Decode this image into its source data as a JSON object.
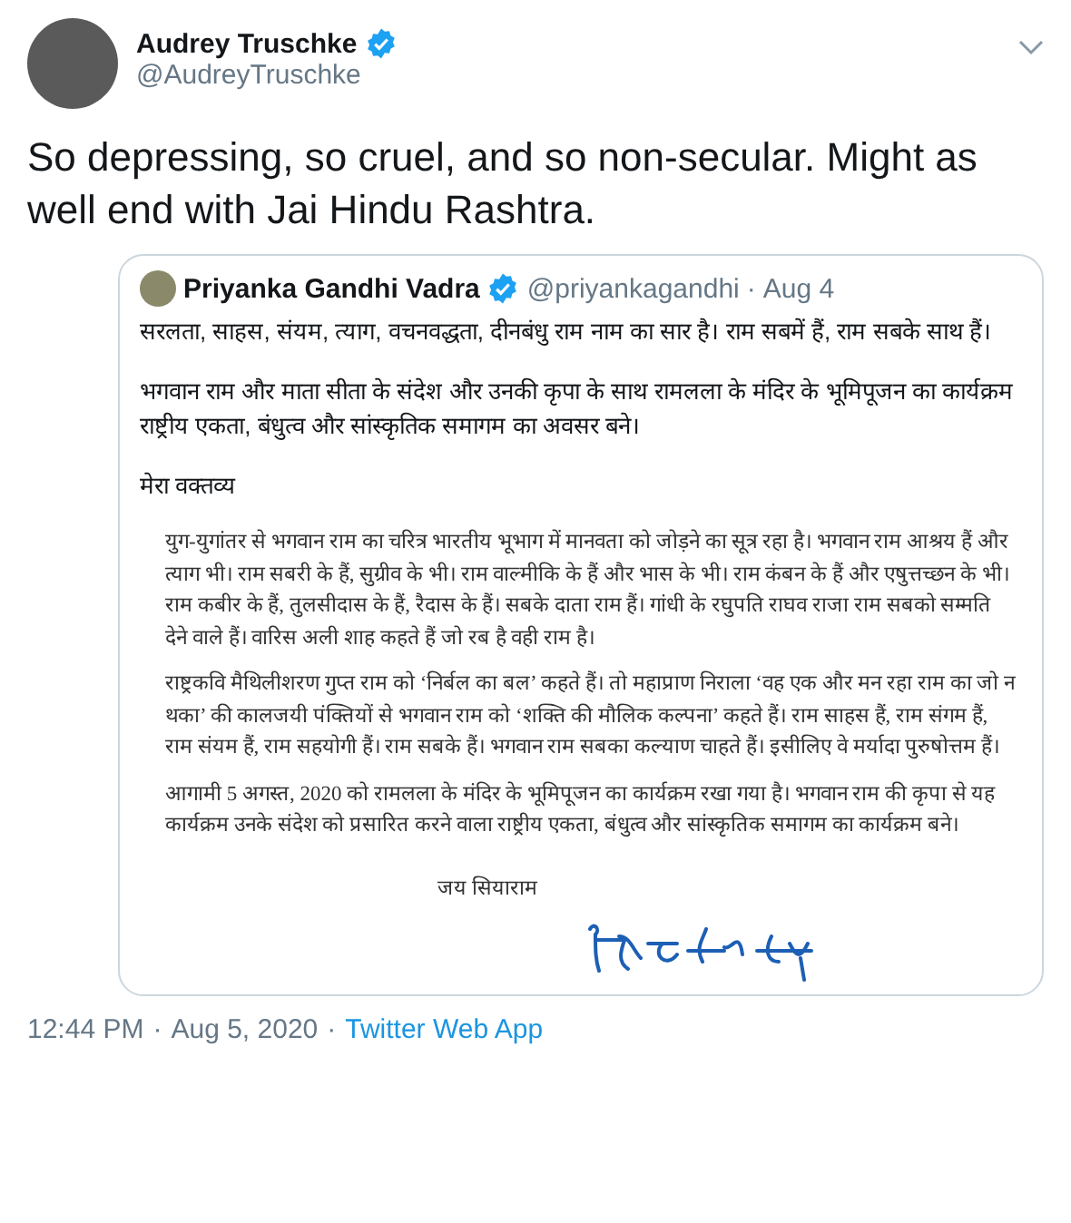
{
  "author": {
    "name": "Audrey Truschke",
    "handle": "@AudreyTruschke",
    "verified": true
  },
  "tweet_text": "So depressing, so cruel, and so non-secular. Might as well end with Jai Hindu Rashtra.",
  "quoted": {
    "name": "Priyanka Gandhi Vadra",
    "verified": true,
    "handle": "@priyankagandhi",
    "separator": "·",
    "time": "Aug 4",
    "paragraphs": [
      "सरलता, साहस, संयम, त्याग, वचनवद्धता, दीनबंधु राम नाम का सार है। राम सबमें हैं, राम सबके साथ हैं।",
      "भगवान राम और माता सीता के संदेश और उनकी कृपा के साथ रामलला के मंदिर के भूमिपूजन का कार्यक्रम राष्ट्रीय एकता, बंधुत्व और सांस्कृतिक समागम का अवसर बने।",
      "मेरा वक्तव्य"
    ],
    "letter": {
      "paragraphs": [
        "युग-युगांतर से भगवान राम का चरित्र भारतीय भूभाग में मानवता को जोड़ने का सूत्र रहा है। भगवान राम आश्रय हैं और त्याग भी। राम सबरी के हैं, सुग्रीव के भी। राम वाल्मीकि के हैं और भास के भी। राम कंबन के हैं और एषुत्तच्छन के भी। राम कबीर के हैं, तुलसीदास के हैं, रैदास के हैं। सबके दाता राम हैं। गांधी के रघुपति राघव राजा राम सबको सम्मति देने वाले हैं। वारिस अली शाह कहते हैं जो रब है वही राम है।",
        "राष्ट्रकवि मैथिलीशरण गुप्त राम को ‘निर्बल का बल’ कहते हैं। तो महाप्राण निराला ‘वह एक और मन रहा राम का जो न थका’ की कालजयी पंक्तियों से भगवान राम को ‘शक्ति की मौलिक कल्पना’ कहते हैं। राम साहस हैं, राम संगम हैं, राम संयम हैं, राम सहयोगी हैं। राम सबके हैं। भगवान राम सबका कल्याण चाहते हैं। इसीलिए वे मर्यादा पुरुषोत्तम हैं।",
        "आगामी 5 अगस्त, 2020 को रामलला के मंदिर के भूमिपूजन का कार्यक्रम रखा गया है। भगवान राम की कृपा से यह कार्यक्रम उनके संदेश को प्रसारित करने वाला राष्ट्रीय एकता, बंधुत्व और सांस्कृतिक समागम का कार्यक्रम बने।"
      ],
      "closing": "जय सियाराम"
    }
  },
  "footer": {
    "time": "12:44 PM",
    "separator_1": "·",
    "date": "Aug 5, 2020",
    "separator_2": "·",
    "source": "Twitter Web App"
  }
}
